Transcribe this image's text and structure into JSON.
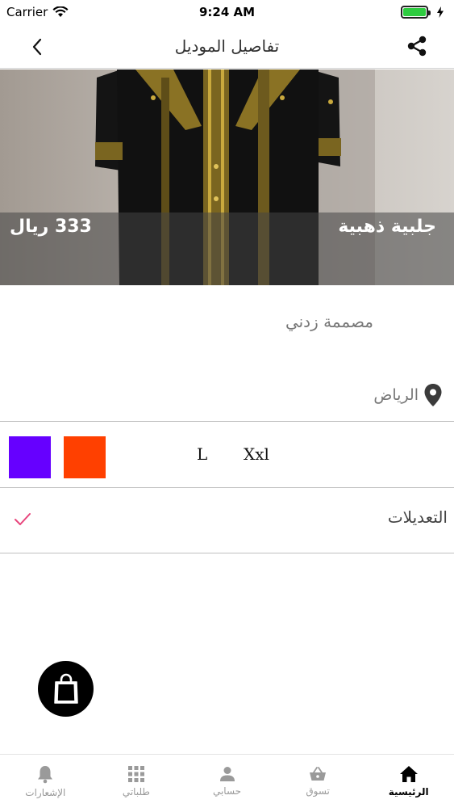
{
  "status_bar": {
    "carrier": "Carrier",
    "time": "9:24 AM"
  },
  "nav": {
    "title": "تفاصيل الموديل",
    "back_icon": "chevron-left-icon",
    "share_icon": "share-icon"
  },
  "product": {
    "name": "جلبية ذهبية",
    "price": "333 ريال",
    "designer": "مصممة زدني",
    "location": "الرياض",
    "location_icon": "map-pin-icon"
  },
  "options": {
    "colors": [
      "#6600ff",
      "#ff4000"
    ],
    "sizes": [
      "L",
      "Xxl"
    ]
  },
  "modifications": {
    "label": "التعديلات",
    "check_color": "#e8457c"
  },
  "cart": {
    "icon": "shopping-bag-icon"
  },
  "tab_bar": {
    "tabs": [
      {
        "label": "الرئيسية",
        "icon": "home-icon",
        "active": true
      },
      {
        "label": "تسوق",
        "icon": "basket-icon",
        "active": false
      },
      {
        "label": "حسابي",
        "icon": "person-icon",
        "active": false
      },
      {
        "label": "طلباتي",
        "icon": "grid-icon",
        "active": false
      },
      {
        "label": "الإشعارات",
        "icon": "bell-icon",
        "active": false
      }
    ]
  }
}
